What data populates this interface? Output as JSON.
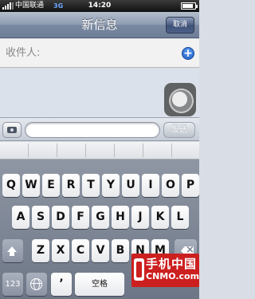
{
  "status_bar": {
    "carrier": "中国联通",
    "network": "3G",
    "time": "14:20"
  },
  "nav": {
    "title": "新信息",
    "cancel_label": "取消"
  },
  "recipient": {
    "label": "收件人:",
    "add_icon": "+"
  },
  "compose": {
    "send_label": "发送"
  },
  "keyboard": {
    "row1": [
      "Q",
      "W",
      "E",
      "R",
      "T",
      "Y",
      "U",
      "I",
      "O",
      "P"
    ],
    "row2": [
      "A",
      "S",
      "D",
      "F",
      "G",
      "H",
      "J",
      "K",
      "L"
    ],
    "row3": [
      "Z",
      "X",
      "C",
      "V",
      "B",
      "N",
      "M"
    ],
    "numbers_label": "123",
    "apostrophe_label": "’",
    "space_label": "空格"
  },
  "watermark": {
    "title": "手机中国",
    "subtitle": "CNMO.com"
  },
  "icons": {
    "signal": "signal-bars-icon",
    "battery": "battery-icon",
    "camera": "camera-icon",
    "shift": "shift-icon",
    "delete": "delete-icon",
    "globe": "globe-icon",
    "assistive": "assistive-touch-icon"
  }
}
